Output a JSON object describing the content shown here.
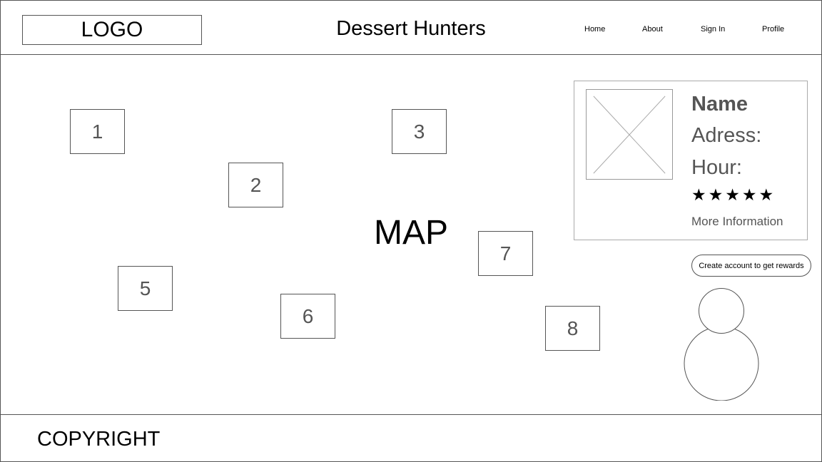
{
  "header": {
    "logo": "LOGO",
    "title": "Dessert Hunters",
    "nav": [
      {
        "label": "Home"
      },
      {
        "label": "About"
      },
      {
        "label": "Sign In"
      },
      {
        "label": "Profile"
      }
    ]
  },
  "map": {
    "label": "MAP",
    "pins": [
      "1",
      "2",
      "3",
      "5",
      "6",
      "7",
      "8"
    ]
  },
  "card": {
    "image_icon": "image-placeholder-icon",
    "name": "Name",
    "address": "Adress:",
    "hour": "Hour:",
    "rating": 5,
    "rating_max": 5,
    "star_glyph": "★",
    "more_link": "More Information"
  },
  "cta": {
    "label": "Create account to get rewards"
  },
  "avatar_icon": "user-avatar-icon",
  "footer": {
    "copyright": "COPYRIGHT"
  }
}
